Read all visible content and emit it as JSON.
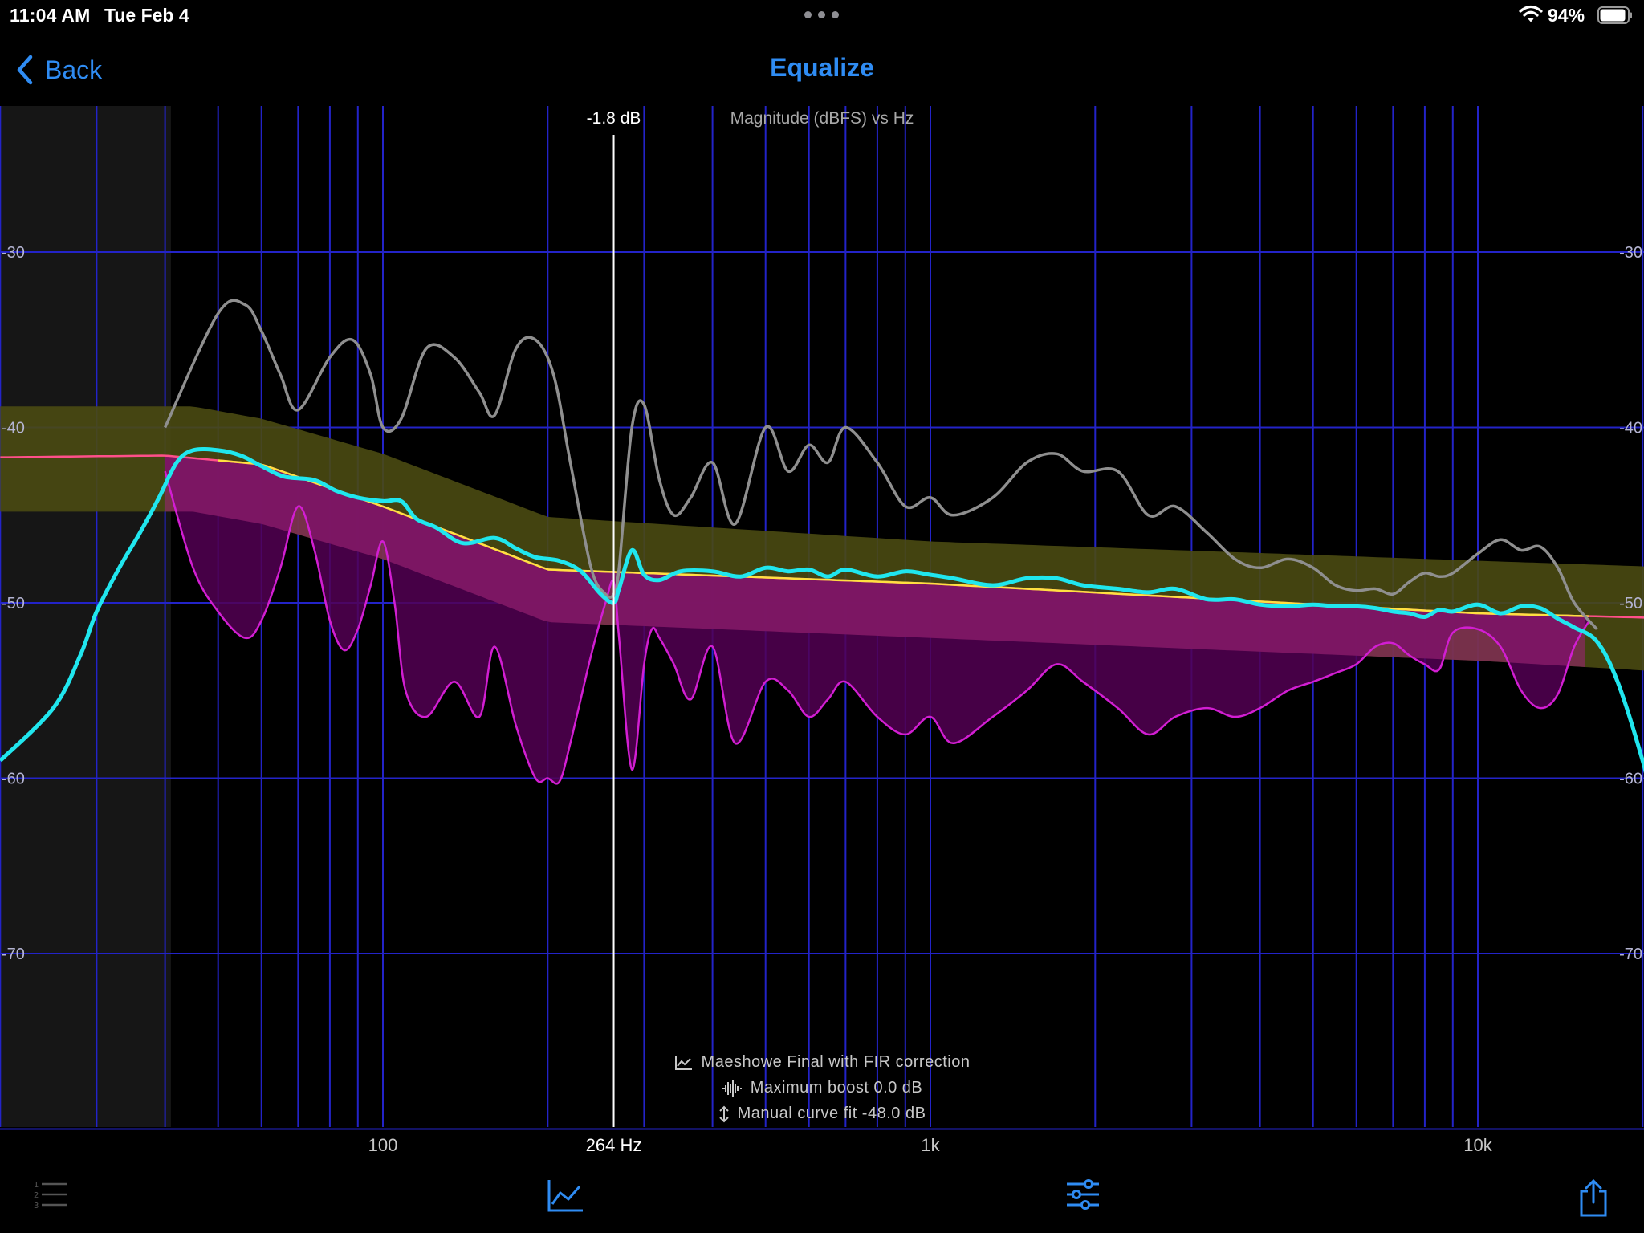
{
  "status_bar": {
    "time": "11:04 AM",
    "date": "Tue Feb 4",
    "battery_percent": "94%",
    "battery_level": 0.94,
    "icons": [
      "more-dots-icon",
      "wifi-icon",
      "battery-icon"
    ]
  },
  "nav": {
    "back_label": "Back",
    "title": "Equalize"
  },
  "colors": {
    "accent": "#2f8cf3",
    "grid": "#2323c8",
    "measurement": "#8f8f8f",
    "corrected": "#20e6ee",
    "target": "#ffe040",
    "target_band": "#4a4a12",
    "filter": "#d21ed2",
    "filter_fill": "#520052",
    "excluded_region": "#161616"
  },
  "chart_data": {
    "type": "line",
    "title": "Magnitude (dBFS) vs Hz",
    "x_scale": "log",
    "xlim": [
      20,
      24000
    ],
    "ylim": [
      -80,
      -22
    ],
    "x_ticks": [
      {
        "value": 100,
        "label": "100"
      },
      {
        "value": 1000,
        "label": "1k"
      },
      {
        "value": 10000,
        "label": "10k"
      }
    ],
    "y_ticks": [
      {
        "value": -30,
        "label": "-30"
      },
      {
        "value": -40,
        "label": "-40"
      },
      {
        "value": -50,
        "label": "-50"
      },
      {
        "value": -60,
        "label": "-60"
      },
      {
        "value": -70,
        "label": "-70"
      }
    ],
    "excluded_below_hz": 41,
    "cursor": {
      "x": 264,
      "x_label": "264 Hz",
      "y_label": "-1.8 dB"
    },
    "target": {
      "x": [
        20,
        40,
        60,
        100,
        200,
        300,
        1000,
        10000,
        24000
      ],
      "y": [
        -41.7,
        -41.6,
        -42.1,
        -44.5,
        -48.1,
        -48.3,
        -48.9,
        -50.6,
        -50.9
      ]
    },
    "target_band": {
      "x": [
        20,
        45,
        60,
        100,
        200,
        1000,
        10000,
        24000
      ],
      "upper": [
        -38.8,
        -38.8,
        -39.5,
        -41.5,
        -45.1,
        -46.5,
        -47.6,
        -48.0
      ],
      "lower": [
        -44.8,
        -44.8,
        -45.5,
        -47.5,
        -51.1,
        -52.0,
        -53.3,
        -54.0
      ]
    },
    "series": [
      {
        "key": "measurement",
        "x": [
          40,
          50,
          56,
          60,
          65,
          70,
          80,
          88,
          95,
          100,
          108,
          120,
          135,
          150,
          160,
          175,
          190,
          205,
          220,
          240,
          255,
          264,
          270,
          285,
          300,
          320,
          340,
          365,
          400,
          440,
          500,
          550,
          600,
          650,
          700,
          800,
          900,
          1000,
          1100,
          1300,
          1500,
          1700,
          1900,
          2200,
          2500,
          2800,
          3200,
          3600,
          4000,
          4500,
          5000,
          5500,
          6000,
          6500,
          7000,
          7500,
          8000,
          8500,
          9000,
          10000,
          11000,
          12000,
          13000,
          14000,
          15000,
          16500
        ],
        "y": [
          -40,
          -33.5,
          -33,
          -34.5,
          -37,
          -39,
          -36,
          -35,
          -37,
          -40,
          -39.5,
          -35.5,
          -36,
          -38,
          -39.3,
          -35.5,
          -35,
          -37,
          -42,
          -48,
          -49.5,
          -49.5,
          -48,
          -40,
          -38.7,
          -43,
          -45,
          -44,
          -42,
          -45.5,
          -40,
          -42.5,
          -41,
          -42,
          -40,
          -42,
          -44.5,
          -44,
          -45,
          -44,
          -42,
          -41.5,
          -42.5,
          -42.5,
          -45,
          -44.5,
          -46,
          -47.5,
          -48,
          -47.5,
          -48,
          -49,
          -49.3,
          -49.2,
          -49.5,
          -48.8,
          -48.3,
          -48.5,
          -48.3,
          -47.2,
          -46.4,
          -47,
          -46.8,
          -48,
          -50,
          -51.5
        ]
      },
      {
        "key": "filter",
        "x": [
          40,
          45,
          50,
          56,
          60,
          65,
          70,
          75,
          80,
          85,
          90,
          95,
          100,
          105,
          110,
          120,
          135,
          150,
          160,
          175,
          190,
          200,
          210,
          220,
          240,
          255,
          264,
          270,
          285,
          300,
          310,
          320,
          340,
          365,
          400,
          440,
          500,
          550,
          600,
          650,
          700,
          800,
          900,
          1000,
          1100,
          1300,
          1500,
          1700,
          1900,
          2200,
          2500,
          2800,
          3200,
          3600,
          4000,
          4500,
          5000,
          5500,
          6000,
          6500,
          7000,
          7500,
          8000,
          8500,
          9000,
          10000,
          11000,
          12000,
          13000,
          14000,
          15000,
          16000
        ],
        "y": [
          -42.5,
          -48,
          -50.5,
          -52,
          -51,
          -48,
          -44.5,
          -47,
          -51,
          -52.7,
          -51.5,
          -49,
          -46.5,
          -50,
          -55,
          -56.5,
          -54.5,
          -56.5,
          -52.5,
          -57,
          -60,
          -60,
          -60.2,
          -58,
          -53,
          -50,
          -48.8,
          -52,
          -59.5,
          -53.5,
          -51.5,
          -52,
          -53.5,
          -55.5,
          -52.5,
          -58,
          -54.5,
          -55,
          -56.5,
          -55.5,
          -54.5,
          -56.5,
          -57.5,
          -56.5,
          -58,
          -56.5,
          -55,
          -53.5,
          -54.5,
          -56,
          -57.5,
          -56.5,
          -56,
          -56.5,
          -56,
          -55,
          -54.5,
          -54,
          -53.5,
          -52.5,
          -52.3,
          -53,
          -53.5,
          -53.8,
          -51.7,
          -51.5,
          -52.5,
          -55,
          -56,
          -55.2,
          -52.5,
          -51
        ]
      },
      {
        "key": "corrected",
        "x": [
          20,
          25,
          28,
          30,
          33,
          36,
          39,
          42,
          45,
          50,
          55,
          60,
          66,
          75,
          82,
          90,
          100,
          108,
          115,
          125,
          140,
          160,
          175,
          190,
          210,
          230,
          250,
          264,
          270,
          285,
          300,
          320,
          350,
          400,
          450,
          500,
          550,
          600,
          650,
          700,
          800,
          900,
          1000,
          1100,
          1300,
          1500,
          1700,
          1900,
          2200,
          2500,
          2800,
          3200,
          3600,
          4000,
          4500,
          5000,
          5500,
          6000,
          6500,
          7000,
          7500,
          8000,
          8500,
          9000,
          10000,
          11000,
          12000,
          13000,
          14000,
          15000,
          16500,
          18000,
          20000,
          22000,
          24000
        ],
        "y": [
          -59,
          -56,
          -53,
          -50.5,
          -48,
          -46,
          -44,
          -42,
          -41.3,
          -41.3,
          -41.6,
          -42.2,
          -42.8,
          -43,
          -43.6,
          -44,
          -44.2,
          -44.2,
          -45.2,
          -45.7,
          -46.6,
          -46.3,
          -46.9,
          -47.4,
          -47.6,
          -48.2,
          -49.5,
          -50,
          -49.2,
          -47,
          -48.4,
          -48.7,
          -48.2,
          -48.2,
          -48.5,
          -48,
          -48.2,
          -48.1,
          -48.5,
          -48.1,
          -48.5,
          -48.2,
          -48.4,
          -48.6,
          -49,
          -48.6,
          -48.6,
          -49,
          -49.2,
          -49.4,
          -49.2,
          -49.8,
          -49.8,
          -50.1,
          -50.2,
          -50.1,
          -50.2,
          -50.2,
          -50.3,
          -50.5,
          -50.6,
          -50.8,
          -50.4,
          -50.5,
          -50.1,
          -50.6,
          -50.2,
          -50.3,
          -50.9,
          -51.4,
          -52.2,
          -54.5,
          -59,
          -64,
          -68
        ]
      }
    ]
  },
  "legend": {
    "measurement_name": "Maeshowe Final with FIR correction",
    "max_boost": "Maximum boost 0.0 dB",
    "curve_fit": "Manual curve fit -48.0 dB"
  },
  "tab_bar": {
    "tabs": [
      "list-icon",
      "chart-icon",
      "sliders-icon",
      "share-icon"
    ],
    "selected": "chart-icon"
  }
}
